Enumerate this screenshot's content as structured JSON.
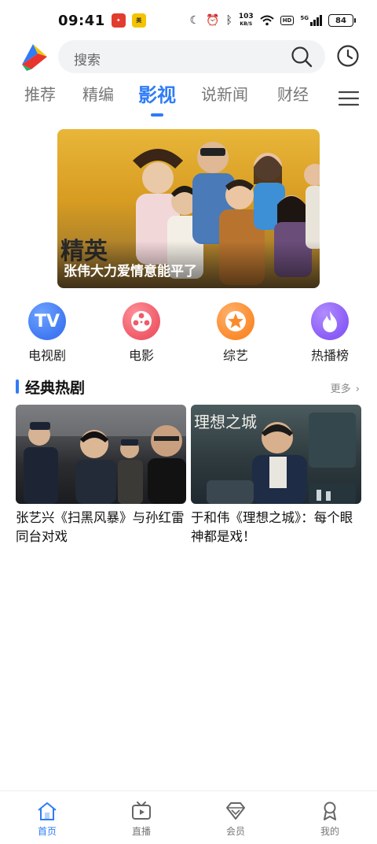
{
  "status_bar": {
    "time": "09:41",
    "net_speed_value": "103",
    "net_speed_unit": "KB/S",
    "hd_label": "HD",
    "signal_label": "5G",
    "battery": "84"
  },
  "search": {
    "placeholder": "搜索"
  },
  "tabs": [
    {
      "label": "推荐",
      "active": false
    },
    {
      "label": "精编",
      "active": false
    },
    {
      "label": "影视",
      "active": true
    },
    {
      "label": "说新闻",
      "active": false
    },
    {
      "label": "财经",
      "active": false
    }
  ],
  "banner": {
    "caption": "张伟大力爱情意能平了",
    "show_logo_text": "精英"
  },
  "categories": [
    {
      "label": "电视剧",
      "icon": "tv-icon",
      "color": "#3f78f2"
    },
    {
      "label": "电影",
      "icon": "film-reel-icon",
      "color": "#ef5a68"
    },
    {
      "label": "综艺",
      "icon": "star-icon",
      "color": "#fb8a2c"
    },
    {
      "label": "热播榜",
      "icon": "flame-icon",
      "color": "#8a5cf6"
    }
  ],
  "section": {
    "title": "经典热剧",
    "more_label": "更多"
  },
  "cards": [
    {
      "title": "张艺兴《扫黑风暴》与孙红雷同台对戏"
    },
    {
      "title": "于和伟《理想之城》：每个眼神都是戏！",
      "thumb_text": "理想之城"
    }
  ],
  "bottom_nav": [
    {
      "label": "首页",
      "icon": "home-icon",
      "active": true
    },
    {
      "label": "直播",
      "icon": "live-tv-icon",
      "active": false
    },
    {
      "label": "会员",
      "icon": "diamond-icon",
      "active": false
    },
    {
      "label": "我的",
      "icon": "profile-icon",
      "active": false
    }
  ],
  "colors": {
    "accent": "#2f7cf6",
    "tab_inactive": "#777777",
    "search_bg": "#f2f3f5"
  }
}
